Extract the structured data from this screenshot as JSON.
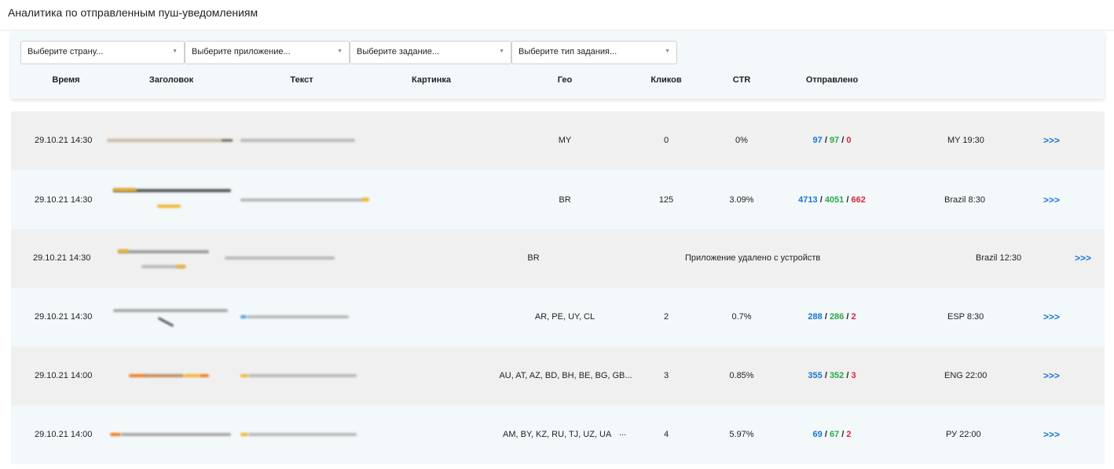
{
  "header": {
    "title": "Аналитика по отправленным пуш-уведомлениям"
  },
  "filters": [
    {
      "placeholder": "Выберите страну..."
    },
    {
      "placeholder": "Выберите приложение..."
    },
    {
      "placeholder": "Выберите задание..."
    },
    {
      "placeholder": "Выберите тип задания..."
    }
  ],
  "columns": {
    "time": "Время",
    "title": "Заголовок",
    "text": "Текст",
    "image": "Картинка",
    "geo": "Гео",
    "clicks": "Кликов",
    "ctr": "CTR",
    "sent": "Отправлено"
  },
  "rows": [
    {
      "time": "29.10.21 14:30",
      "geo": "MY",
      "clicks": "0",
      "ctr": "0%",
      "sent_total": "97",
      "sent_ok": "97",
      "sent_fail": "0",
      "schedule": "MY 19:30",
      "more": ">>>"
    },
    {
      "time": "29.10.21 14:30",
      "geo": "BR",
      "clicks": "125",
      "ctr": "3.09%",
      "sent_total": "4713",
      "sent_ok": "4051",
      "sent_fail": "662",
      "schedule": "Brazil 8:30",
      "more": ">>>"
    },
    {
      "time": "29.10.21 14:30",
      "geo": "BR",
      "status": "Приложение удалено с устройств",
      "schedule": "Brazil 12:30",
      "more": ">>>"
    },
    {
      "time": "29.10.21 14:30",
      "geo": "AR, PE, UY, CL",
      "clicks": "2",
      "ctr": "0.7%",
      "sent_total": "288",
      "sent_ok": "286",
      "sent_fail": "2",
      "schedule": "ESP 8:30",
      "more": ">>>"
    },
    {
      "time": "29.10.21 14:00",
      "geo": "AU, AT, AZ, BD, BH, BE, BG, GB...",
      "clicks": "3",
      "ctr": "0.85%",
      "sent_total": "355",
      "sent_ok": "352",
      "sent_fail": "3",
      "schedule": "ENG 22:00",
      "more": ">>>"
    },
    {
      "time": "29.10.21 14:00",
      "geo": "AM, BY, KZ, RU, TJ, UZ, UA",
      "geo_more": "...",
      "clicks": "4",
      "ctr": "5.97%",
      "sent_total": "69",
      "sent_ok": "67",
      "sent_fail": "2",
      "schedule": "РУ 22:00",
      "more": ">>>"
    }
  ],
  "separator": "/",
  "colors": {
    "total": "#1976d2",
    "ok": "#2aa84a",
    "fail": "#d7263d",
    "row_alt": "#f3f8fb",
    "row": "#f0f0f0"
  }
}
